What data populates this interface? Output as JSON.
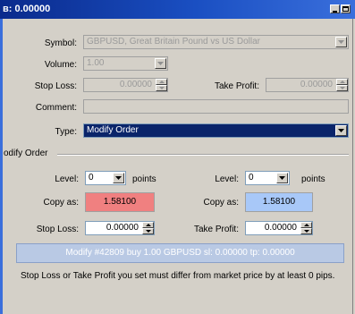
{
  "window": {
    "title": "в: 0.00000"
  },
  "form": {
    "symbol": {
      "label": "Symbol:",
      "value": "GBPUSD, Great Britain Pound vs US Dollar"
    },
    "volume": {
      "label": "Volume:",
      "value": "1.00"
    },
    "stop_loss": {
      "label": "Stop Loss:",
      "value": "0.00000"
    },
    "take_profit": {
      "label": "Take Profit:",
      "value": "0.00000"
    },
    "comment": {
      "label": "Comment:",
      "value": ""
    },
    "type": {
      "label": "Type:",
      "value": "Modify Order"
    }
  },
  "modify": {
    "group_label": "odify Order",
    "left": {
      "level_label": "Level:",
      "level_value": "0",
      "points_label": "points",
      "copy_label": "Copy as:",
      "copy_value": "1.58100",
      "sl_label": "Stop Loss:",
      "sl_value": "0.00000"
    },
    "right": {
      "level_label": "Level:",
      "level_value": "0",
      "points_label": "points",
      "copy_label": "Copy as:",
      "copy_value": "1.58100",
      "tp_label": "Take Profit:",
      "tp_value": "0.00000"
    },
    "modify_button": "Modify #42809 buy 1.00 GBPUSD sl: 0.00000 tp: 0.00000",
    "note": "Stop Loss or Take Profit you set must differ from market price by at least 0 pips."
  },
  "colors": {
    "copy_sl": "#f08080",
    "copy_tp": "#a8c8f8",
    "selected_bg": "#0a246a"
  }
}
